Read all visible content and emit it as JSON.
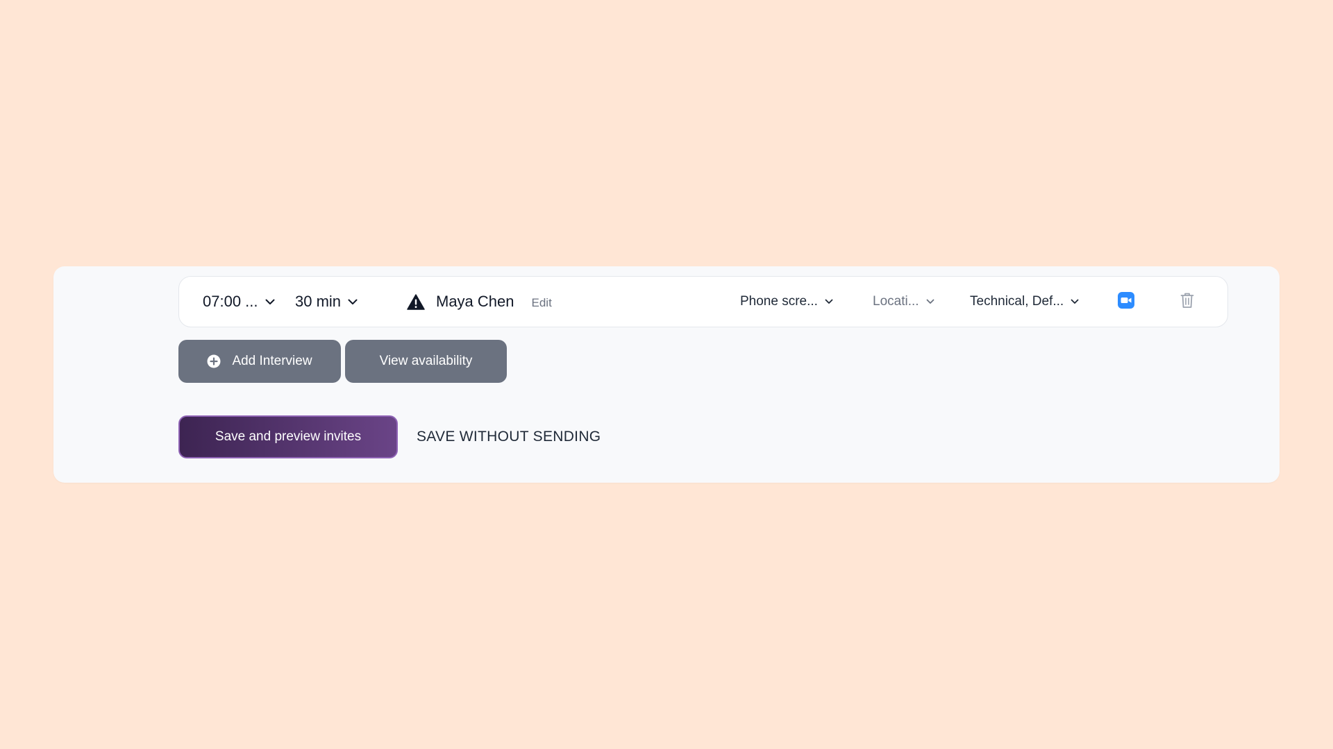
{
  "interview": {
    "time": "07:00 ...",
    "duration": "30 min",
    "interviewer_name": "Maya Chen",
    "edit_label": "Edit",
    "interview_type": "Phone scre...",
    "location_placeholder": "Locati...",
    "tags": "Technical, Def..."
  },
  "actions": {
    "add_interview_label": "Add Interview",
    "view_availability_label": "View availability",
    "save_preview_label": "Save and preview invites",
    "save_without_sending_label": "SAVE WITHOUT SENDING"
  },
  "icons": {
    "warning": "warning-triangle-icon",
    "video": "zoom-video-icon",
    "trash": "trash-icon",
    "plus": "plus-circle-icon",
    "chevron": "chevron-down-icon"
  },
  "colors": {
    "background": "#ffe6d5",
    "panel": "#f8f9fb",
    "gray_button": "#6b7280",
    "primary_start": "#3d2452",
    "primary_end": "#6a4487",
    "video_blue": "#2d8cff"
  }
}
